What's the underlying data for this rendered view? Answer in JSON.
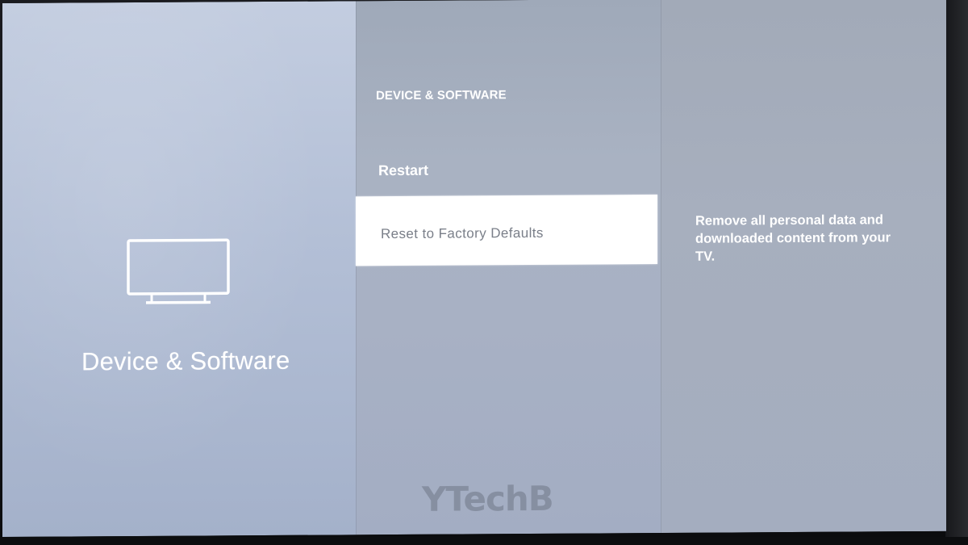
{
  "left_panel": {
    "icon": "tv-icon",
    "title": "Device & Software"
  },
  "middle_panel": {
    "header": "DEVICE & SOFTWARE",
    "items": [
      {
        "label": "Restart",
        "selected": false
      },
      {
        "label": "Reset to Factory Defaults",
        "selected": true
      }
    ]
  },
  "right_panel": {
    "description": "Remove all personal data and downloaded content from your TV."
  },
  "watermark": "YTechB",
  "colors": {
    "left_bg": "#b3bfd6",
    "middle_bg": "#a9b2c2",
    "right_bg": "#a7afbe",
    "selected_bg": "#ffffff",
    "selected_text": "#7a7f89",
    "text": "#ffffff"
  }
}
